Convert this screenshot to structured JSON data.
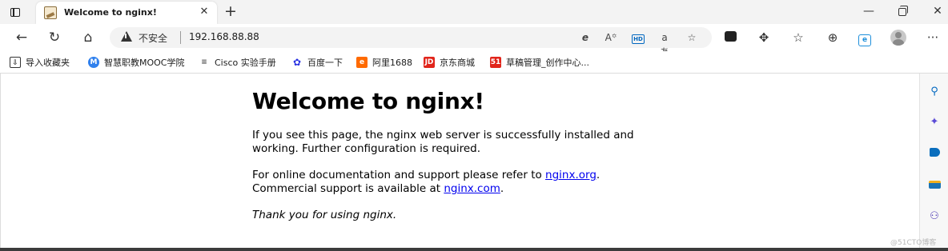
{
  "tab": {
    "title": "Welcome to nginx!",
    "close_glyph": "✕",
    "new_tab_glyph": "+"
  },
  "window": {
    "minimize_glyph": "—",
    "close_glyph": "✕"
  },
  "toolbar": {
    "back_glyph": "←",
    "reload_glyph": "↻",
    "home_glyph": "⌂",
    "security_label": "不安全",
    "url": "192.168.88.88",
    "more_glyph": "···"
  },
  "bookmarks": [
    {
      "label": "导入收藏夹",
      "icon": "import-icon",
      "color": "#555555",
      "glyph": "⇩"
    },
    {
      "label": "智慧职教MOOC学院",
      "icon": "mooc-logo-icon",
      "color": "#2f80ed",
      "glyph": "M"
    },
    {
      "label": "Cisco 实验手册",
      "icon": "cisco-icon",
      "color": "#6c6c6c",
      "glyph": "≡"
    },
    {
      "label": "百度一下",
      "icon": "baidu-paw-icon",
      "color": "#2932e1",
      "glyph": "✿"
    },
    {
      "label": "阿里1688",
      "icon": "alibaba-icon",
      "color": "#ff6a00",
      "glyph": "e"
    },
    {
      "label": "京东商城",
      "icon": "jd-icon",
      "color": "#e1251b",
      "glyph": "JD"
    },
    {
      "label": "草稿管理_创作中心...",
      "icon": "51cto-icon",
      "color": "#e1251b",
      "glyph": "51"
    }
  ],
  "page": {
    "heading": "Welcome to nginx!",
    "para1": "If you see this page, the nginx web server is successfully installed and working. Further configuration is required.",
    "para2_prefix": "For online documentation and support please refer to ",
    "link1": "nginx.org",
    "para2_mid": ".",
    "para2_line2_prefix": "Commercial support is available at ",
    "link2": "nginx.com",
    "para2_suffix": ".",
    "thanks": "Thank you for using nginx."
  },
  "watermark": "@51CTO博客",
  "colors": {
    "link": "#0000ee",
    "tab_bar": "#f3f3f3"
  }
}
